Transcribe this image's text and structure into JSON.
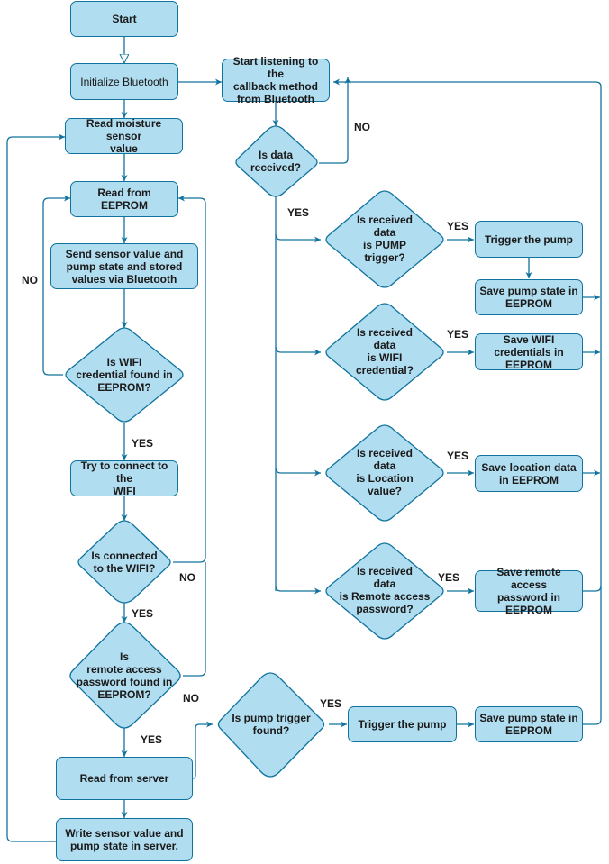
{
  "colors": {
    "fill": "#b1ddf0",
    "stroke": "#10739e",
    "text": "#1a1a1a"
  },
  "nodes": {
    "start": "Start",
    "init_bt": "Initialize Bluetooth",
    "read_moisture": "Read moisture sensor\nvalue",
    "read_eeprom": "Read from EEPROM",
    "send_values": "Send sensor value and\npump state and stored\nvalues via Bluetooth",
    "wifi_cred_q": "Is WIFI\ncredential found in\nEEPROM?",
    "try_connect": "Try to connect to the\nWIFI",
    "connected_q": "Is connected\nto the WIFI?",
    "remote_pw_q": "Is\nremote access\npassword found in\nEEPROM?",
    "read_server": "Read from server",
    "write_server": "Write sensor value and\npump state in server.",
    "pump_found_q": "Is pump trigger\nfound?",
    "trigger_pump_2": "Trigger the pump",
    "save_pump_2": "Save pump state in\nEEPROM",
    "start_listening": "Start listening to the\ncallback method\nfrom Bluetooth",
    "data_received_q": "Is data\nreceived?",
    "pump_trigger_q": "Is received\ndata\nis PUMP\ntrigger?",
    "trigger_pump_1": "Trigger the pump",
    "save_pump_1": "Save pump state in\nEEPROM",
    "wifi_data_q": "Is received\ndata\nis WIFI\ncredential?",
    "save_wifi": "Save WIFI\ncredentials in\nEEPROM",
    "location_q": "Is received\ndata\nis Location\nvalue?",
    "save_location": "Save location data\nin EEPROM",
    "remote_data_q": "Is received\ndata\nis Remote access\npassword?",
    "save_remote": "Save remote access\npassword in\nEEPROM"
  },
  "labels": {
    "no_wifi_cred": "NO",
    "yes_wifi_cred": "YES",
    "no_connected": "NO",
    "yes_connected": "YES",
    "no_remote_pw": "NO",
    "yes_remote_pw": "YES",
    "yes_pump_found": "YES",
    "no_data": "NO",
    "yes_data": "YES",
    "yes_pump_trigger": "YES",
    "yes_wifi_data": "YES",
    "yes_location": "YES",
    "yes_remote_data": "YES"
  }
}
